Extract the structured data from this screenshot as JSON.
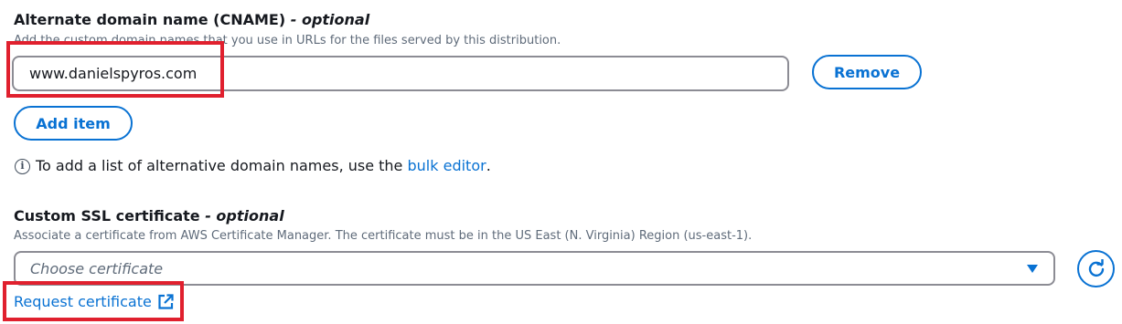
{
  "cname_section": {
    "label": "Alternate domain name (CNAME)",
    "label_optional": "- optional",
    "description": "Add the custom domain names that you use in URLs for the files served by this distribution.",
    "item_value": "www.danielspyros.com",
    "remove_label": "Remove",
    "add_item_label": "Add item",
    "info_text": "To add a list of alternative domain names, use the",
    "info_link": "bulk editor",
    "info_suffix": "."
  },
  "ssl_section": {
    "label": "Custom SSL certificate",
    "label_optional": "- optional",
    "description": "Associate a certificate from AWS Certificate Manager. The certificate must be in the US East (N. Virginia) Region (us-east-1).",
    "select_placeholder": "Choose certificate",
    "request_link": "Request certificate"
  },
  "icons": {
    "info": "info-icon",
    "caret": "caret-down-icon",
    "refresh": "refresh-icon",
    "external": "external-link-icon"
  },
  "colors": {
    "link": "#0972d3",
    "highlight": "#e0202e",
    "border": "#8c8c94",
    "text": "#16191f",
    "muted": "#5f6b7a"
  }
}
